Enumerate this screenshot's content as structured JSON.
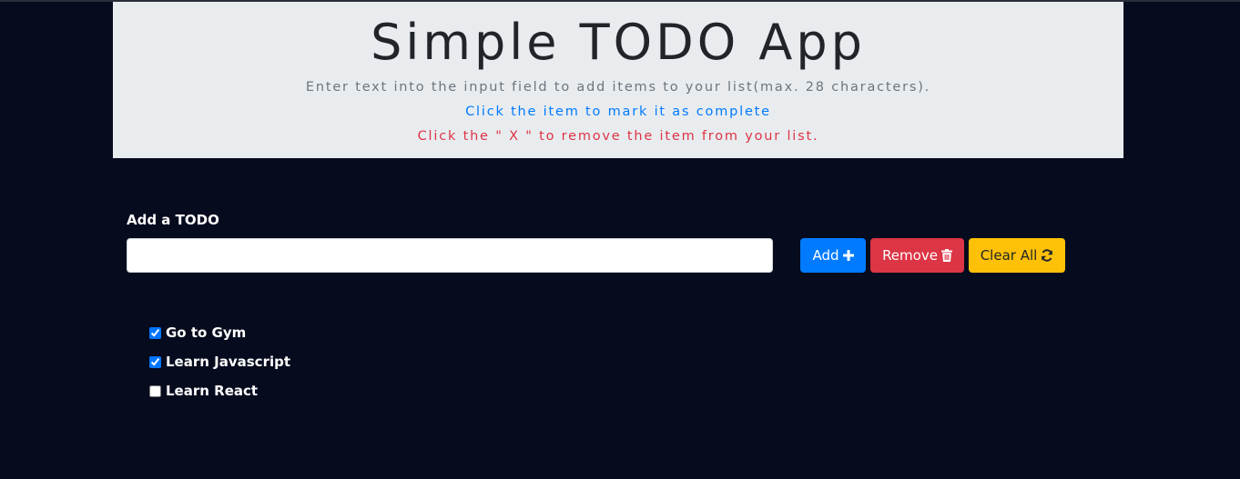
{
  "header": {
    "title": "Simple TODO App",
    "instruction_add": "Enter text into the input field to add items to your list(max. 28 characters).",
    "instruction_complete": "Click the item to mark it as complete",
    "instruction_remove": "Click the \" X \" to remove the item from your list."
  },
  "form": {
    "label": "Add a TODO",
    "input_value": "",
    "add_label": "Add",
    "remove_label": "Remove",
    "clear_label": "Clear All"
  },
  "todos": [
    {
      "text": "Go to Gym",
      "checked": true
    },
    {
      "text": "Learn Javascript",
      "checked": true
    },
    {
      "text": "Learn React",
      "checked": false
    }
  ],
  "colors": {
    "background": "#060b1e",
    "header_bg": "#e9ecef",
    "add": "#007bff",
    "remove": "#dc3545",
    "clear": "#ffc107"
  },
  "icons": {
    "add": "plus-icon",
    "remove": "trash-icon",
    "clear": "sync-icon"
  }
}
